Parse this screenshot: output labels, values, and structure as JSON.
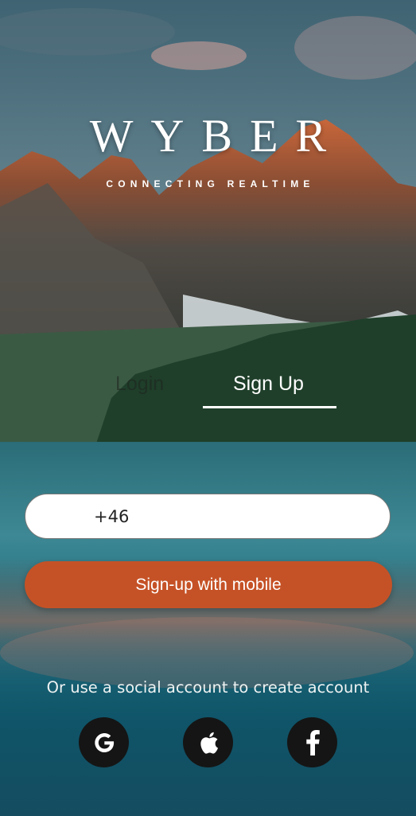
{
  "brand": {
    "title": "WYBER",
    "subtitle": "CONNECTING REALTIME"
  },
  "tabs": [
    {
      "label": "Login",
      "active": false
    },
    {
      "label": "Sign Up",
      "active": true
    }
  ],
  "phone": {
    "value": "+46",
    "placeholder": ""
  },
  "signup_button": {
    "label": "Sign-up with mobile"
  },
  "social": {
    "prompt": "Or use a social account to create account",
    "providers": [
      {
        "name": "google",
        "icon": "google-icon"
      },
      {
        "name": "apple",
        "icon": "apple-icon"
      },
      {
        "name": "facebook",
        "icon": "facebook-icon"
      }
    ]
  },
  "colors": {
    "accent": "#c55226",
    "social_button_bg": "#151515",
    "input_bg": "#ffffff"
  }
}
